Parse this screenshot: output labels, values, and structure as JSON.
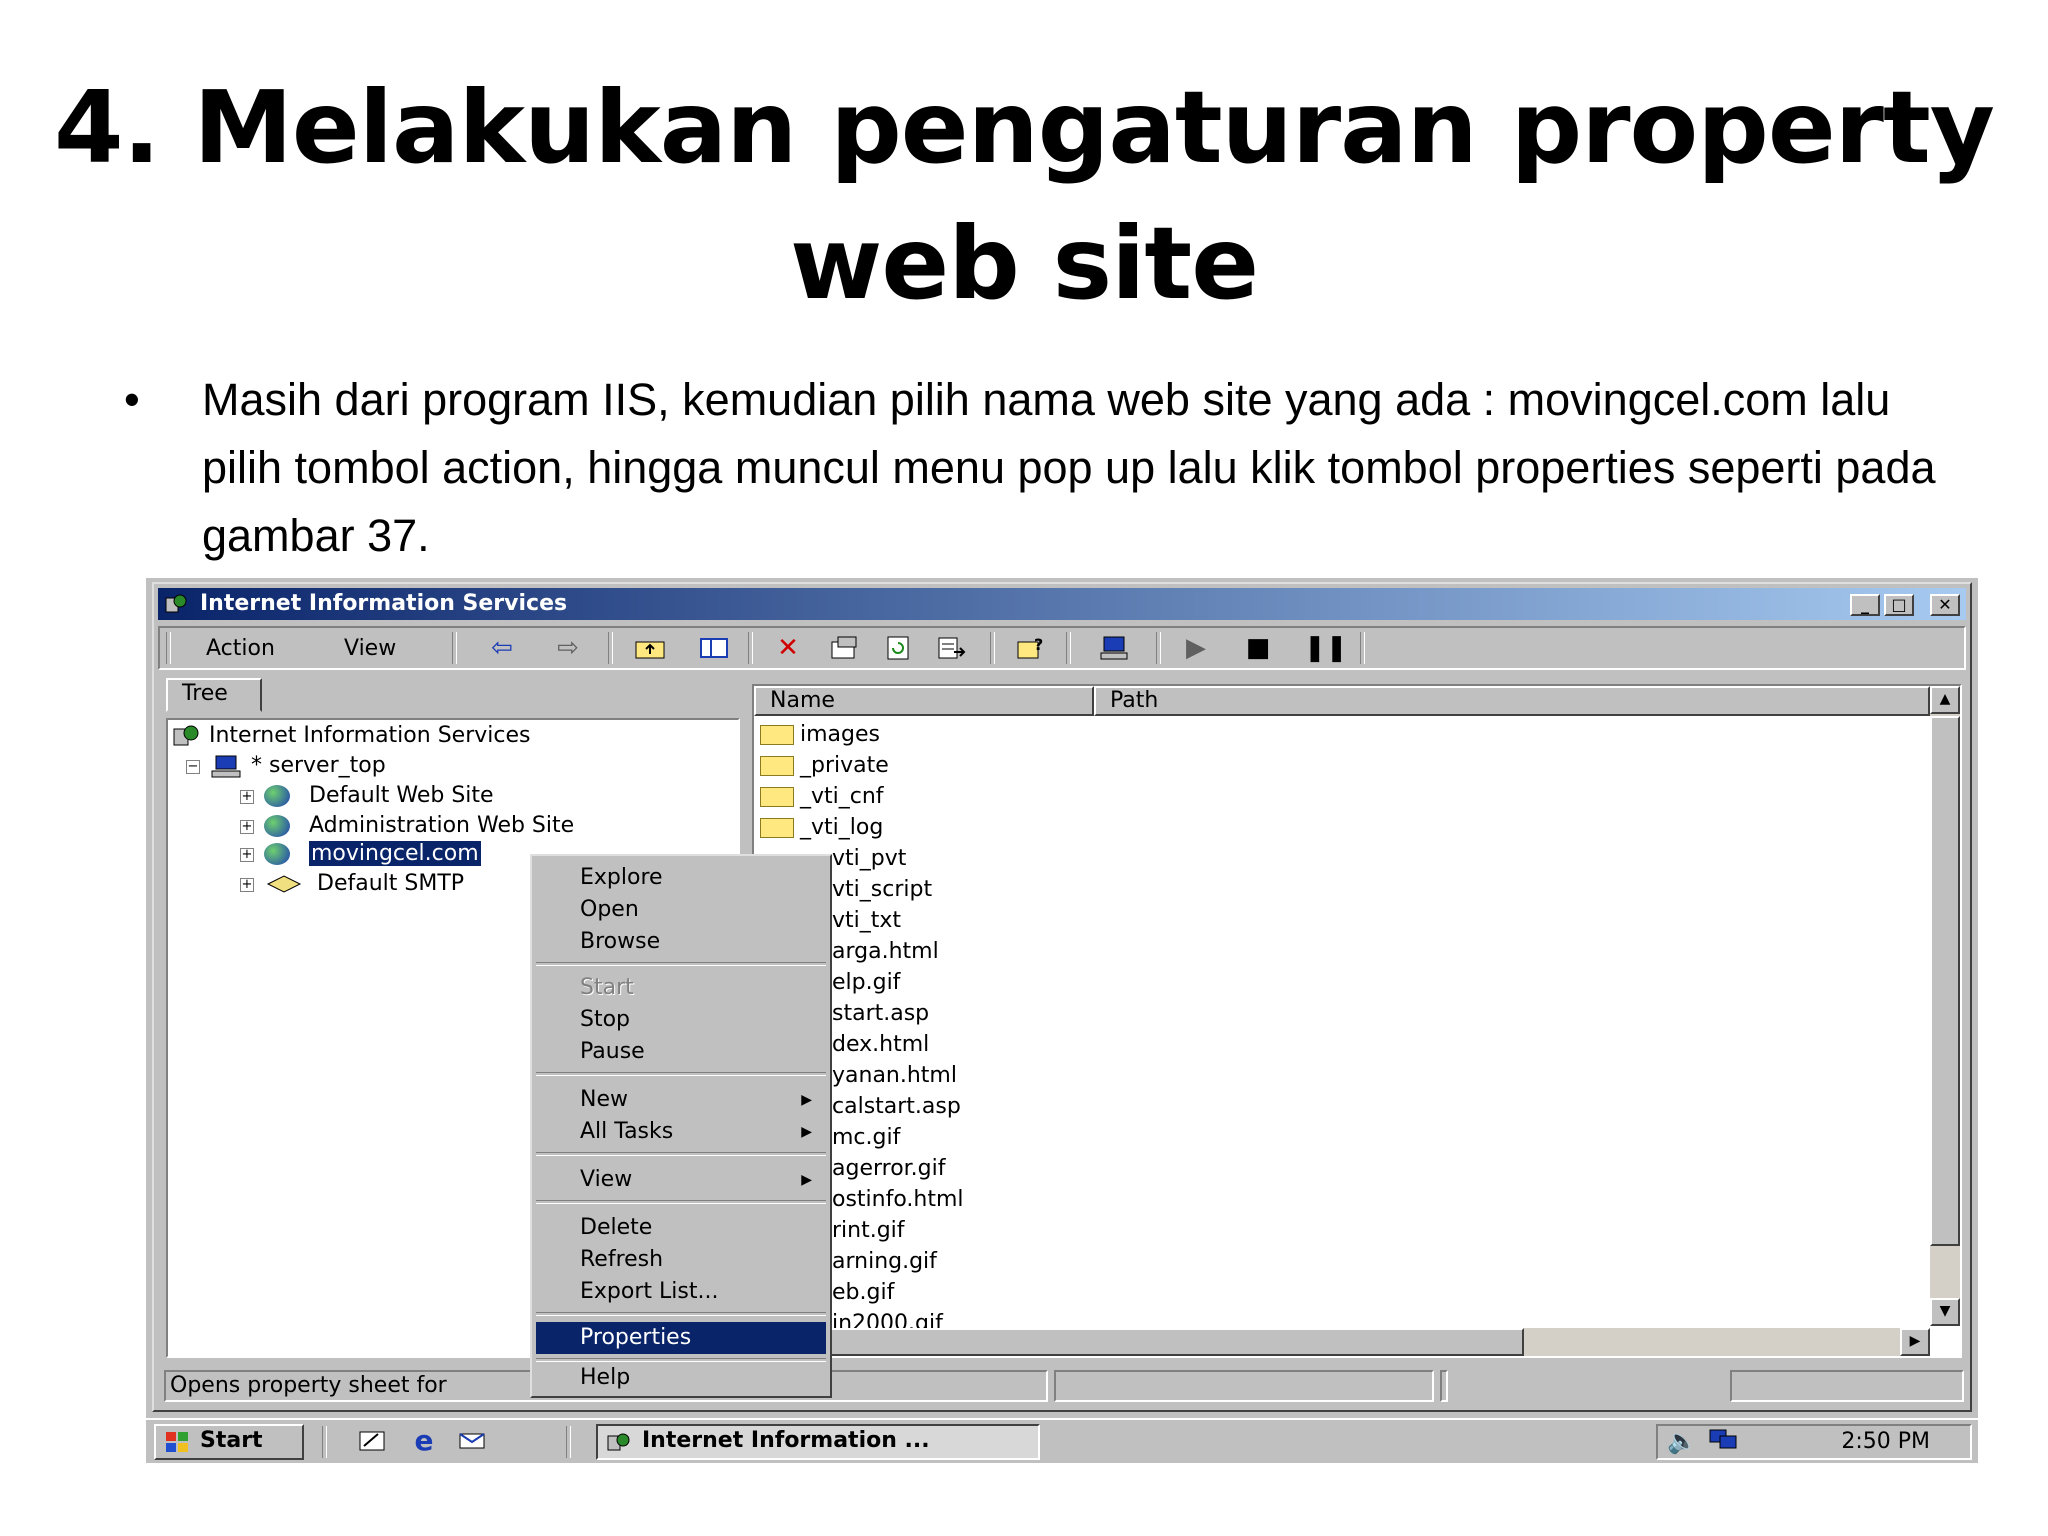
{
  "slide": {
    "title_line1": "4. Melakukan pengaturan property",
    "title_line2": "web site",
    "bullet_marker": "•",
    "bullet_text": "Masih dari program IIS, kemudian pilih nama web site yang ada : movingcel.com lalu pilih tombol action, hingga muncul menu pop up lalu klik tombol properties seperti pada gambar 37."
  },
  "window": {
    "title": "Internet Information Services",
    "controls": {
      "minimize": "_",
      "maximize": "□",
      "close": "✕"
    }
  },
  "toolbar": {
    "action_label": "Action",
    "view_label": "View"
  },
  "tree": {
    "tab_label": "Tree",
    "root": "Internet Information Services",
    "server": "* server_top",
    "sites": [
      "Default Web Site",
      "Administration Web Site",
      "movingcel.com",
      "Default SMTP"
    ]
  },
  "list": {
    "col_name": "Name",
    "col_path": "Path",
    "folders": [
      "images",
      "_private",
      "_vti_cnf",
      "_vti_log"
    ],
    "partial_items": [
      "vti_pvt",
      "vti_script",
      "vti_txt",
      "arga.html",
      "elp.gif",
      "start.asp",
      "dex.html",
      "yanan.html",
      "calstart.asp",
      "mc.gif",
      "agerror.gif",
      "ostinfo.html",
      "rint.gif",
      "arning.gif",
      "eb.gif",
      "in2000.gif"
    ]
  },
  "context_menu": {
    "explore": "Explore",
    "open": "Open",
    "browse": "Browse",
    "start": "Start",
    "stop": "Stop",
    "pause": "Pause",
    "new": "New",
    "all_tasks": "All Tasks",
    "view": "View",
    "delete": "Delete",
    "refresh": "Refresh",
    "export_list": "Export List...",
    "properties": "Properties",
    "help": "Help"
  },
  "statusbar": {
    "text": "Opens property sheet for"
  },
  "taskbar": {
    "start_label": "Start",
    "task_label": "Internet Information ...",
    "clock": "2:50 PM"
  }
}
